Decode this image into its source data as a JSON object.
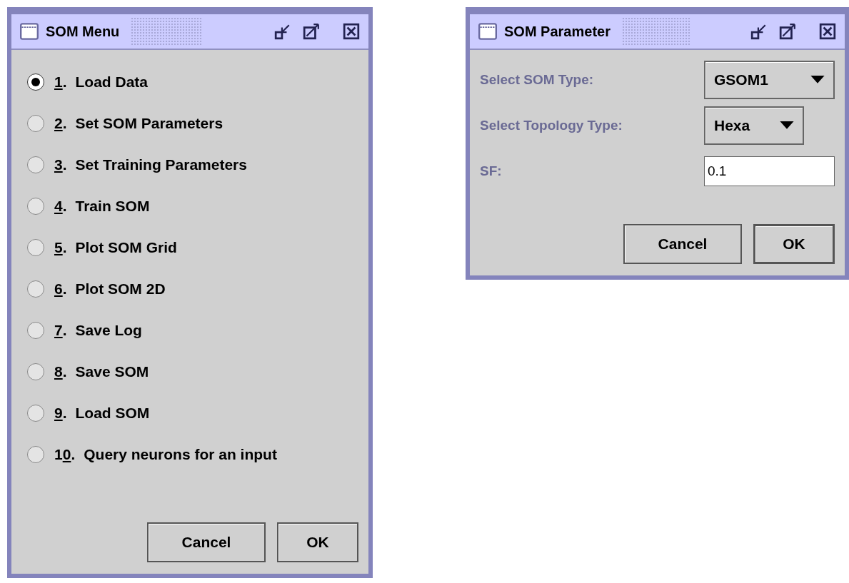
{
  "windows": [
    {
      "kind": "menu",
      "title": "SOM Menu",
      "options": [
        {
          "key": "1",
          "after": ".",
          "label": "Load Data",
          "selected": true
        },
        {
          "key": "2",
          "after": ".",
          "label": "Set SOM Parameters",
          "selected": false
        },
        {
          "key": "3",
          "after": ".",
          "label": "Set Training Parameters",
          "selected": false
        },
        {
          "key": "4",
          "after": ".",
          "label": "Train SOM",
          "selected": false
        },
        {
          "key": "5",
          "after": ".",
          "label": "Plot SOM Grid",
          "selected": false
        },
        {
          "key": "6",
          "after": ".",
          "label": "Plot SOM 2D",
          "selected": false
        },
        {
          "key": "7",
          "after": ".",
          "label": "Save Log",
          "selected": false
        },
        {
          "key": "8",
          "after": ".",
          "label": "Save SOM",
          "selected": false
        },
        {
          "key": "9",
          "after": ".",
          "label": "Load SOM",
          "selected": false
        },
        {
          "before": "1",
          "key": "0",
          "after": ".",
          "label": "Query neurons for an input",
          "selected": false
        }
      ],
      "buttons": [
        "Cancel",
        "OK"
      ]
    },
    {
      "kind": "form",
      "title": "SOM Parameter",
      "fields": [
        {
          "kind": "dropdown",
          "label": "Select SOM Type:",
          "value": "GSOM1"
        },
        {
          "kind": "dropdown",
          "label": "Select Topology Type:",
          "value": "Hexa"
        },
        {
          "kind": "text",
          "label": "SF:",
          "value": "0.1"
        }
      ],
      "buttons": [
        "Cancel",
        "OK"
      ]
    }
  ]
}
